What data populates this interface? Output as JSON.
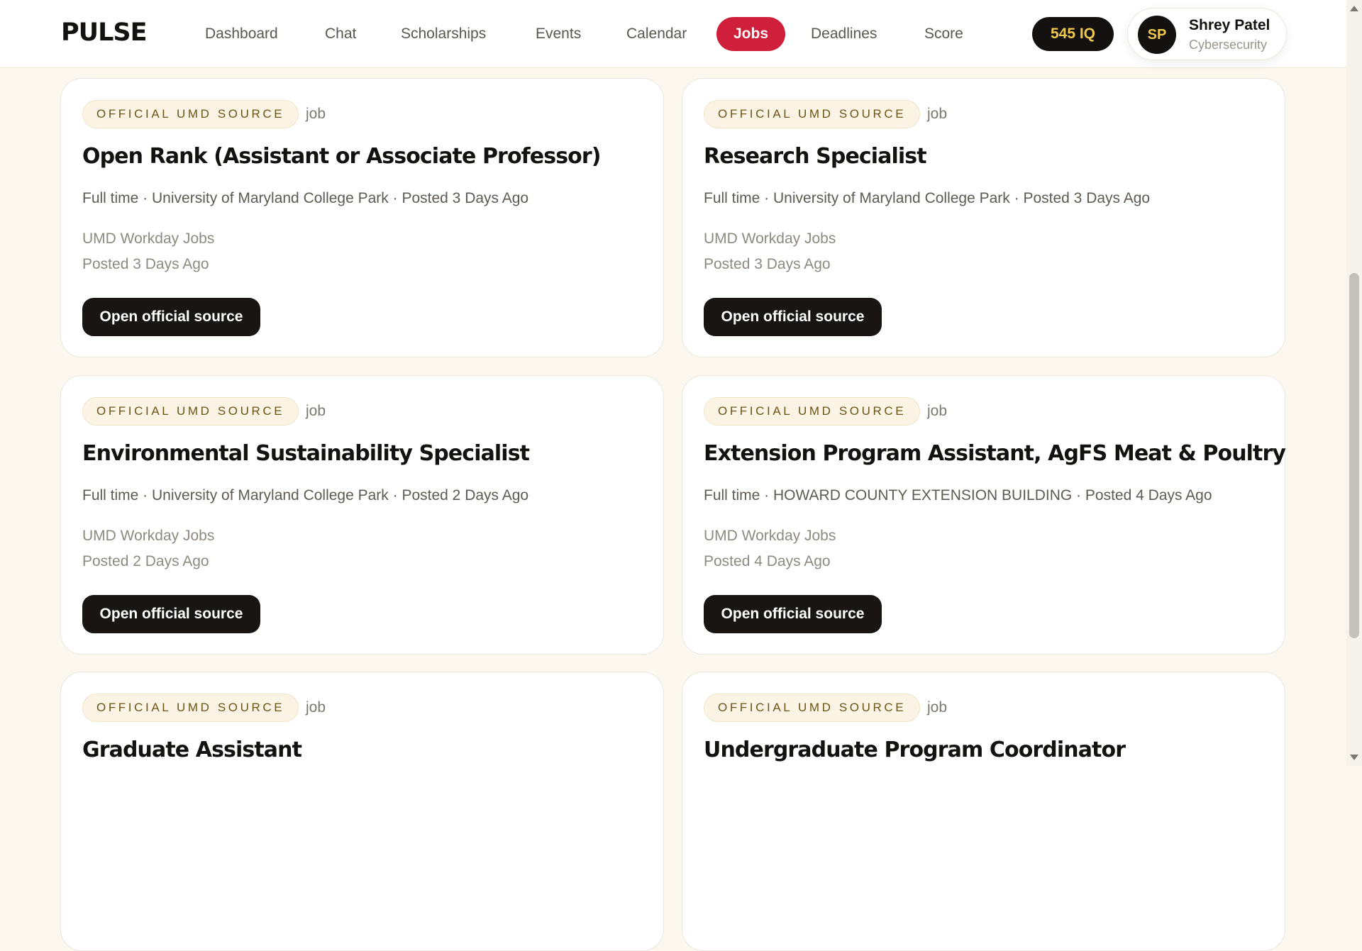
{
  "app": {
    "brand": "PULSE"
  },
  "nav": {
    "items": [
      {
        "label": "Dashboard"
      },
      {
        "label": "Chat"
      },
      {
        "label": "Scholarships"
      },
      {
        "label": "Events"
      },
      {
        "label": "Calendar"
      },
      {
        "label": "Jobs"
      },
      {
        "label": "Deadlines"
      },
      {
        "label": "Score"
      }
    ],
    "active": "Jobs"
  },
  "iq": {
    "label": "545 IQ"
  },
  "user": {
    "initials": "SP",
    "name": "Shrey Patel",
    "major": "Cybersecurity"
  },
  "jobs": [
    {
      "badge": "OFFICIAL UMD SOURCE",
      "kind": "job",
      "title": "Open Rank (Assistant or Associate Professor)",
      "meta": "Full time · University of Maryland College Park · Posted 3 Days Ago",
      "source": "UMD Workday Jobs",
      "posted": "Posted 3 Days Ago",
      "button": "Open official source"
    },
    {
      "badge": "OFFICIAL UMD SOURCE",
      "kind": "job",
      "title": "Research Specialist",
      "meta": "Full time · University of Maryland College Park · Posted 3 Days Ago",
      "source": "UMD Workday Jobs",
      "posted": "Posted 3 Days Ago",
      "button": "Open official source"
    },
    {
      "badge": "OFFICIAL UMD SOURCE",
      "kind": "job",
      "title": "Environmental Sustainability Specialist",
      "meta": "Full time · University of Maryland College Park · Posted 2 Days Ago",
      "source": "UMD Workday Jobs",
      "posted": "Posted 2 Days Ago",
      "button": "Open official source"
    },
    {
      "badge": "OFFICIAL UMD SOURCE",
      "kind": "job",
      "title": "Extension Program Assistant, AgFS Meat & Poultry",
      "meta": "Full time · HOWARD COUNTY EXTENSION BUILDING · Posted 4 Days Ago",
      "source": "UMD Workday Jobs",
      "posted": "Posted 4 Days Ago",
      "button": "Open official source"
    },
    {
      "badge": "OFFICIAL UMD SOURCE",
      "kind": "job",
      "title": "Graduate Assistant"
    },
    {
      "badge": "OFFICIAL UMD SOURCE",
      "kind": "job",
      "title": "Undergraduate Program Coordinator"
    }
  ],
  "colors": {
    "accent": "#cf1f3a",
    "dark": "#141210",
    "gold": "#f0c94c",
    "page_bg": "#fcf8f0",
    "badge_bg": "#fbf4e4",
    "badge_text": "#6b5418"
  }
}
